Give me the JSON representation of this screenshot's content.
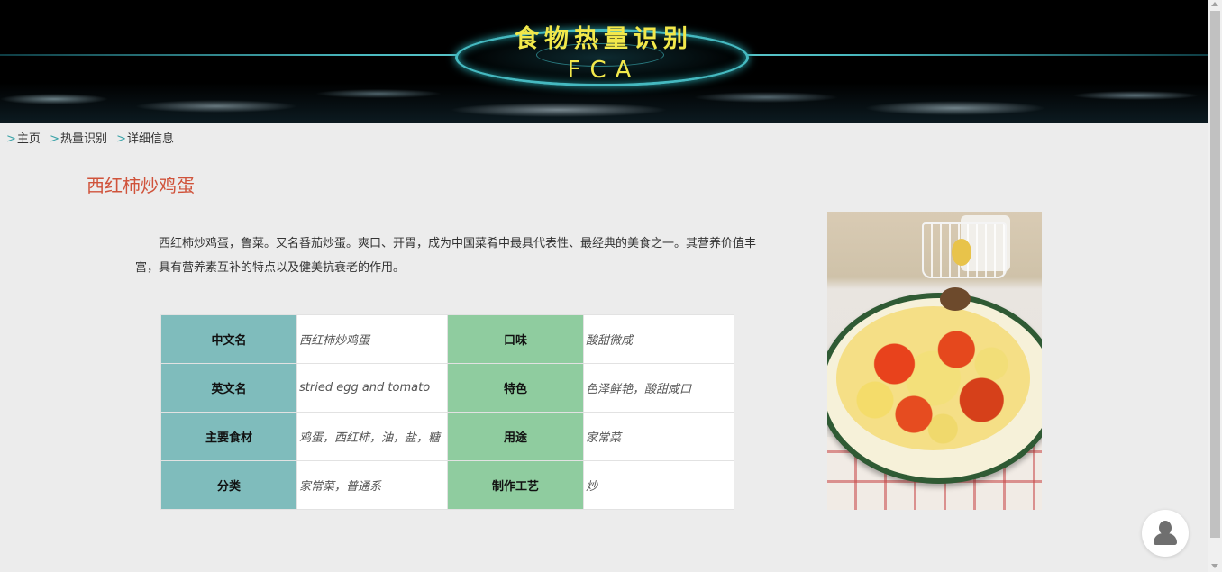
{
  "header": {
    "title": "食物热量识别",
    "subtitle": "FCA"
  },
  "breadcrumb": {
    "separator": ">",
    "items": [
      "主页",
      "热量识别",
      "详细信息"
    ]
  },
  "dish": {
    "name": "西红柿炒鸡蛋",
    "description": "西红柿炒鸡蛋，鲁菜。又名番茄炒蛋。爽口、开胃，成为中国菜肴中最具代表性、最经典的美食之一。其营养价值丰富，具有营养素互补的特点以及健美抗衰老的作用。",
    "info_rows": [
      {
        "label1": "中文名",
        "value1": "西红柿炒鸡蛋",
        "label2": "口味",
        "value2": "酸甜微咸"
      },
      {
        "label1": "英文名",
        "value1": "stried egg and tomato",
        "label2": "特色",
        "value2": "色泽鲜艳，酸甜咸口"
      },
      {
        "label1": "主要食材",
        "value1": "鸡蛋，西红柿，油，盐，糖",
        "label2": "用途",
        "value2": "家常菜"
      },
      {
        "label1": "分类",
        "value1": "家常菜，普通系",
        "label2": "制作工艺",
        "value2": "炒"
      }
    ]
  },
  "colors": {
    "title_accent": "#d0533b",
    "banner_text": "#f2e84b",
    "label_teal": "#7fbcbc",
    "label_green": "#8fcc9f",
    "breadcrumb_sep": "#3aa3a8"
  },
  "icons": {
    "chat_avatar": "user-avatar-icon"
  }
}
